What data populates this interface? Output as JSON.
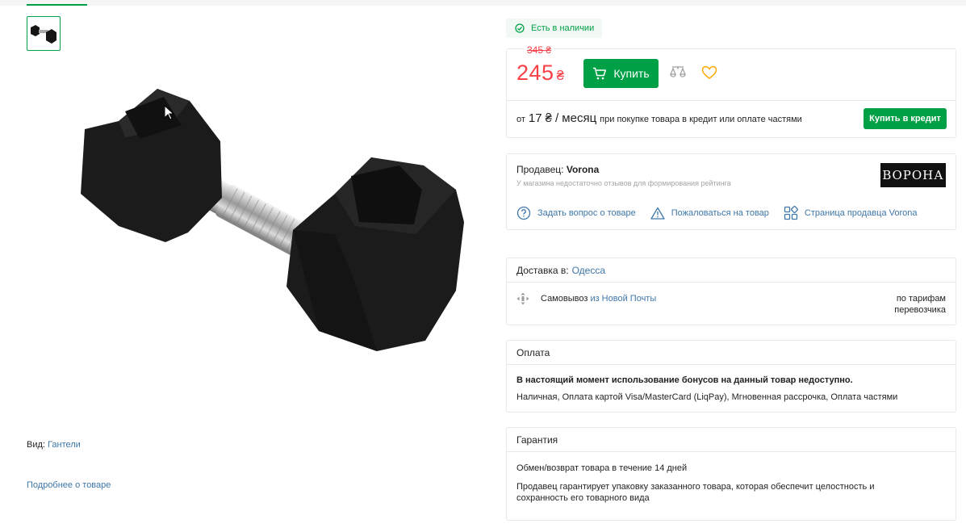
{
  "gallery": {
    "thumbnail_alt": "",
    "product_type_label": "Вид:",
    "product_type_value": "Гантели",
    "more_link": "Подробнее о товаре"
  },
  "availability": {
    "status": "Есть в наличии"
  },
  "buy": {
    "old_price": "345 ₴",
    "price": "245",
    "currency": "₴",
    "buy_label": "Купить",
    "credit_from": "от",
    "credit_amount": "17",
    "credit_currency": "₴",
    "credit_period": "/ месяц",
    "credit_text": "при покупке товара в кредит или оплате частями",
    "credit_button": "Купить в кредит"
  },
  "seller": {
    "label": "Продавец:",
    "name": "Vorona",
    "note": "У магазина недостаточно отзывов для формирования рейтинга",
    "logo_text": "ВОРОНА",
    "actions": [
      "Задать вопрос о товаре",
      "Пожаловаться на товар",
      "Страница продавца Vorona"
    ]
  },
  "delivery": {
    "label": "Доставка в:",
    "city": "Одесса",
    "pickup_prefix": "Самовывоз",
    "pickup_link": "из Новой Почты",
    "tariff": "по тарифам перевозчика"
  },
  "payment": {
    "title": "Оплата",
    "bonus_notice": "В настоящий момент использование бонусов на данный товар недоступно.",
    "methods": "Наличная, Оплата картой Visa/MasterCard (LiqPay), Мгновенная рассрочка, Оплата частями"
  },
  "warranty": {
    "title": "Гарантия",
    "return_policy": "Обмен/возврат товара в течение 14 дней",
    "guarantee": "Продавец гарантирует упаковку заказанного товара, которая обеспечит целостность и сохранность его товарного вида"
  },
  "colors": {
    "accent": "#00a046",
    "price": "#f84147",
    "link": "#3e77aa"
  }
}
